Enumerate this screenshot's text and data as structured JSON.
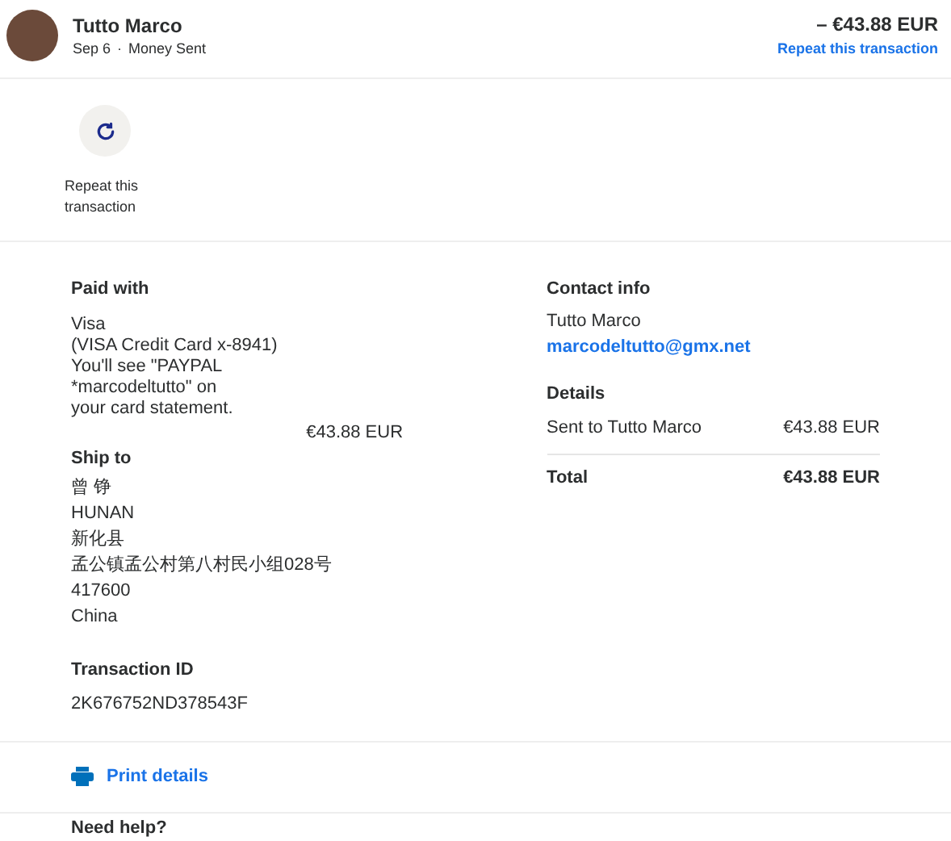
{
  "header": {
    "name": "Tutto Marco",
    "date": "Sep 6",
    "separator": "·",
    "type": "Money Sent",
    "amount": "– €43.88 EUR",
    "repeat_link": "Repeat this transaction"
  },
  "actions": [
    {
      "label": "Repeat this transaction"
    }
  ],
  "paid_with": {
    "title": "Paid with",
    "lines": [
      "Visa",
      "(VISA Credit Card x-8941)",
      "You'll see \"PAYPAL",
      "*marcodeltutto\" on",
      "your card statement."
    ],
    "amount": "€43.88 EUR"
  },
  "ship_to": {
    "title": "Ship to",
    "lines": [
      "曾 铮",
      "HUNAN",
      "新化县",
      "孟公镇孟公村第八村民小组028号",
      "417600",
      "China"
    ]
  },
  "transaction_id": {
    "title": "Transaction ID",
    "value": "2K676752ND378543F"
  },
  "contact_info": {
    "title": "Contact info",
    "name": "Tutto Marco",
    "email": "marcodeltutto@gmx.net"
  },
  "details": {
    "title": "Details",
    "rows": [
      {
        "label": "Sent to Tutto Marco",
        "amount": "€43.88 EUR"
      }
    ],
    "total_label": "Total",
    "total_amount": "€43.88 EUR"
  },
  "print_link": "Print details",
  "help_title": "Need help?"
}
